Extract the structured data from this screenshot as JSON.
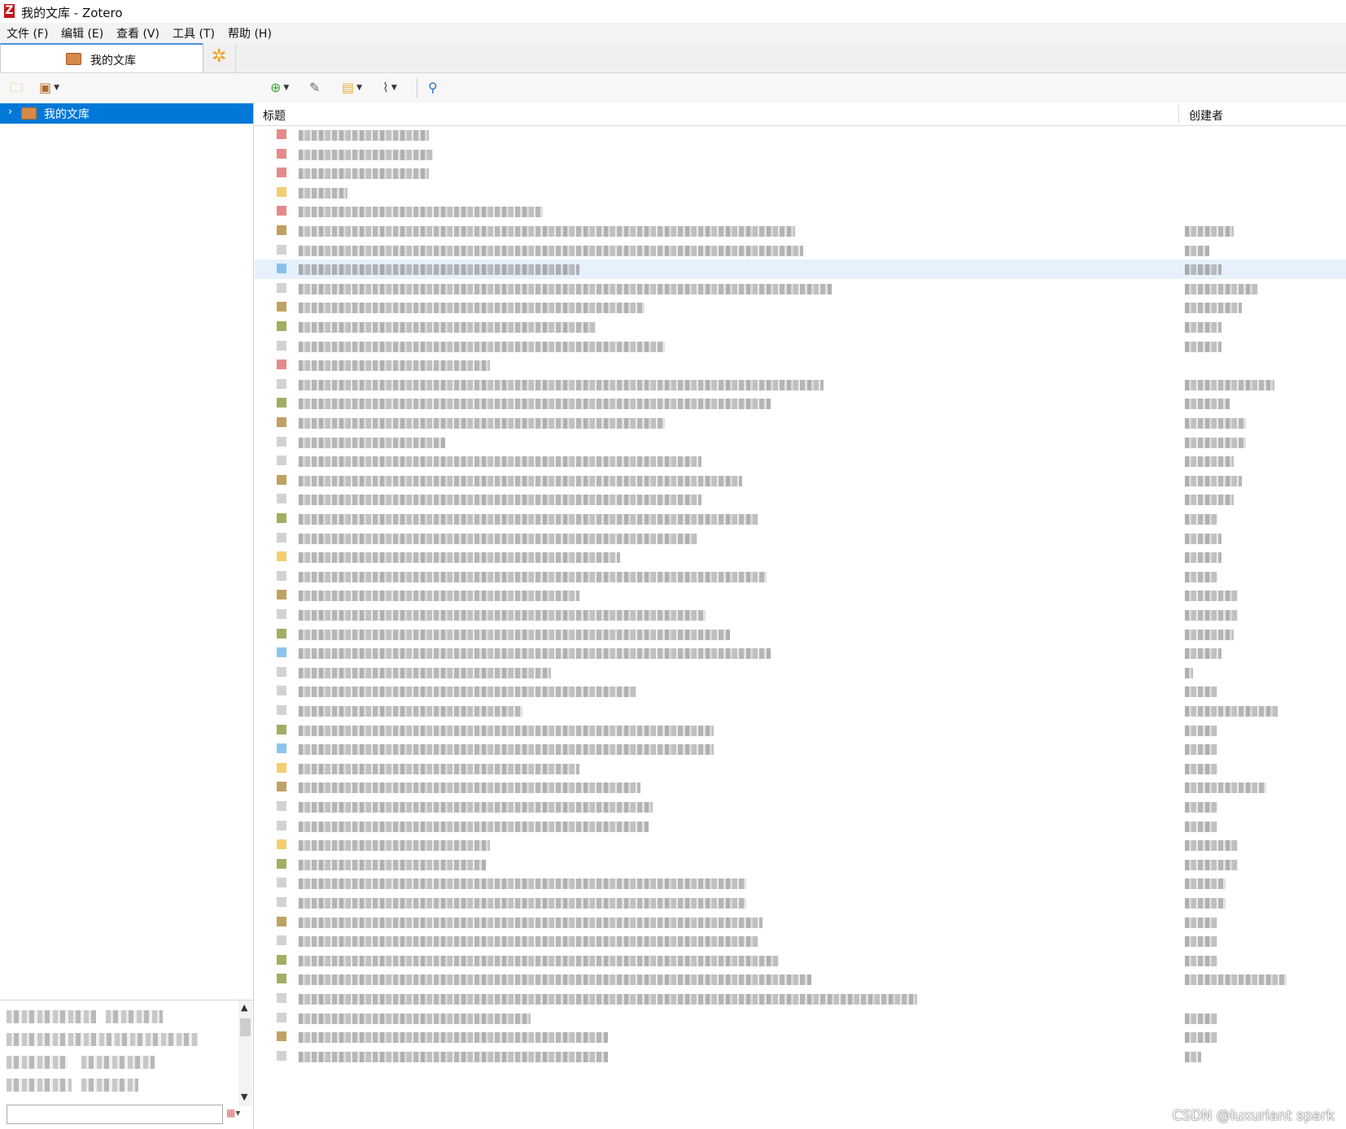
{
  "window": {
    "title": "我的文库 - Zotero",
    "app_logo_letter": "Z"
  },
  "menubar": [
    "文件 (F)",
    "编辑 (E)",
    "查看 (V)",
    "工具 (T)",
    "帮助 (H)"
  ],
  "tabs": {
    "library_tab": "我的文库"
  },
  "collections": {
    "selected": "我的文库"
  },
  "items": {
    "columns": {
      "title": "标题",
      "creator": "创建者"
    },
    "rows": [
      {
        "type": "#e06c6c",
        "t": 160,
        "a": 0
      },
      {
        "type": "#e06c6c",
        "t": 165,
        "a": 0
      },
      {
        "type": "#e06c6c",
        "t": 160,
        "a": 0
      },
      {
        "type": "#f2c14e",
        "t": 60,
        "a": 0
      },
      {
        "type": "#e06c6c",
        "t": 300,
        "a": 0
      },
      {
        "type": "#b08a3a",
        "t": 610,
        "a": 60
      },
      {
        "type": "#c7c7c7",
        "t": 620,
        "a": 30
      },
      {
        "type": "#6fb6e8",
        "t": 345,
        "a": 45,
        "selected": true
      },
      {
        "type": "#c7c7c7",
        "t": 655,
        "a": 90
      },
      {
        "type": "#b08a3a",
        "t": 425,
        "a": 70
      },
      {
        "type": "#8a9a3a",
        "t": 365,
        "a": 45
      },
      {
        "type": "#c7c7c7",
        "t": 450,
        "a": 45
      },
      {
        "type": "#e06c6c",
        "t": 235,
        "a": 0
      },
      {
        "type": "#c7c7c7",
        "t": 645,
        "a": 110
      },
      {
        "type": "#8a9a3a",
        "t": 580,
        "a": 55
      },
      {
        "type": "#b08a3a",
        "t": 450,
        "a": 75
      },
      {
        "type": "#c7c7c7",
        "t": 180,
        "a": 75
      },
      {
        "type": "#c7c7c7",
        "t": 495,
        "a": 60
      },
      {
        "type": "#b08a3a",
        "t": 545,
        "a": 70
      },
      {
        "type": "#c7c7c7",
        "t": 495,
        "a": 60
      },
      {
        "type": "#8a9a3a",
        "t": 565,
        "a": 40
      },
      {
        "type": "#c7c7c7",
        "t": 490,
        "a": 45
      },
      {
        "type": "#f2c14e",
        "t": 395,
        "a": 45
      },
      {
        "type": "#c7c7c7",
        "t": 575,
        "a": 40
      },
      {
        "type": "#b08a3a",
        "t": 345,
        "a": 65
      },
      {
        "type": "#c7c7c7",
        "t": 500,
        "a": 65
      },
      {
        "type": "#8a9a3a",
        "t": 530,
        "a": 60
      },
      {
        "type": "#6fb6e8",
        "t": 580,
        "a": 45
      },
      {
        "type": "#c7c7c7",
        "t": 310,
        "a": 10
      },
      {
        "type": "#c7c7c7",
        "t": 415,
        "a": 40
      },
      {
        "type": "#c7c7c7",
        "t": 275,
        "a": 115
      },
      {
        "type": "#8a9a3a",
        "t": 510,
        "a": 40
      },
      {
        "type": "#6fb6e8",
        "t": 510,
        "a": 40
      },
      {
        "type": "#f2c14e",
        "t": 345,
        "a": 40
      },
      {
        "type": "#b08a3a",
        "t": 420,
        "a": 100
      },
      {
        "type": "#c7c7c7",
        "t": 435,
        "a": 40
      },
      {
        "type": "#c7c7c7",
        "t": 430,
        "a": 40
      },
      {
        "type": "#f2c14e",
        "t": 235,
        "a": 65
      },
      {
        "type": "#8a9a3a",
        "t": 230,
        "a": 65
      },
      {
        "type": "#c7c7c7",
        "t": 550,
        "a": 50
      },
      {
        "type": "#c7c7c7",
        "t": 550,
        "a": 50
      },
      {
        "type": "#b08a3a",
        "t": 570,
        "a": 40
      },
      {
        "type": "#c7c7c7",
        "t": 565,
        "a": 40
      },
      {
        "type": "#8a9a3a",
        "t": 590,
        "a": 40
      },
      {
        "type": "#8a9a3a",
        "t": 630,
        "a": 125
      },
      {
        "type": "#c7c7c7",
        "t": 760,
        "a": 0
      },
      {
        "type": "#c7c7c7",
        "t": 285,
        "a": 40
      },
      {
        "type": "#b08a3a",
        "t": 380,
        "a": 40
      },
      {
        "type": "#c7c7c7",
        "t": 380,
        "a": 20
      }
    ]
  },
  "watermark": "CSDN @luxuriant spark"
}
